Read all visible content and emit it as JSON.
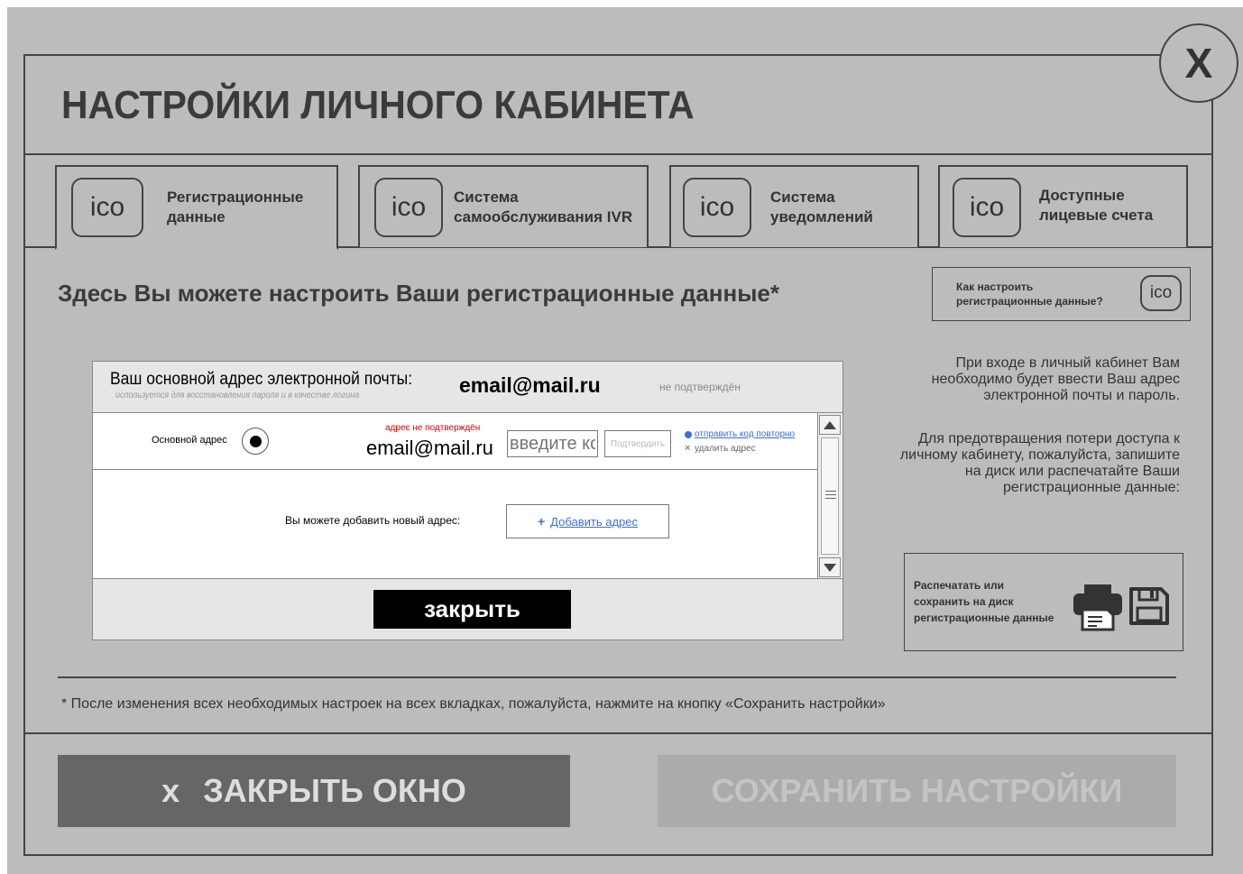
{
  "window": {
    "title": "НАСТРОЙКИ ЛИЧНОГО КАБИНЕТА",
    "close_glyph": "X"
  },
  "tabs": [
    {
      "icon": "ico",
      "label_line1": "Регистрационные",
      "label_line2": "данные",
      "active": true
    },
    {
      "icon": "ico",
      "label_line1": "Система",
      "label_line2": "самообслуживания IVR",
      "active": false
    },
    {
      "icon": "ico",
      "label_line1": "Система",
      "label_line2": "уведомлений",
      "active": false
    },
    {
      "icon": "ico",
      "label_line1": "Доступные",
      "label_line2": "лицевые счета",
      "active": false
    }
  ],
  "section": {
    "title": "Здесь Вы можете настроить Ваши регистрационные данные*"
  },
  "help": {
    "line1": "Как настроить",
    "line2": "регистрационные данные?",
    "icon": "ico"
  },
  "dialog": {
    "header_label": "Ваш основной адрес электронной почты:",
    "header_sublabel": "используется для восстановления пароля и в качестве логина",
    "header_email": "email@mail.ru",
    "header_status": "не подтверждён",
    "row": {
      "label": "Основной адрес",
      "warning": "адрес не подтверждён",
      "email": "email@mail.ru",
      "code_placeholder": "введите код",
      "confirm_label": "Подтвердить",
      "resend_label": "отправить код повторно",
      "delete_label": "удалить адрес"
    },
    "add_label": "Вы можете добавить новый адрес:",
    "add_button_icon": "+",
    "add_button_label": "Добавить адрес",
    "close_label": "закрыть"
  },
  "side": {
    "paragraph1": [
      "При входе в личный кабинет Вам",
      "необходимо будет ввести Ваш адрес",
      "электронной почты и пароль."
    ],
    "paragraph2": [
      "Для предотвращения потери доступа к",
      "личному кабинету, пожалуйста, запишите",
      "на диск или распечатайте Ваши",
      "регистрационные данные:"
    ],
    "print_text": [
      "Распечатать или",
      "сохранить на диск",
      "регистрационные данные"
    ]
  },
  "footnote": "* После изменения всех необходимых настроек на всех вкладках, пожалуйста, нажмите на кнопку «Сохранить настройки»",
  "buttons": {
    "close_prefix": "x",
    "close_label": "ЗАКРЫТЬ ОКНО",
    "save_label": "СОХРАНИТЬ НАСТРОЙКИ"
  },
  "colors": {
    "background": "#bcbcbc",
    "border": "#444444",
    "link": "#3a6fd8",
    "warning": "#e00000",
    "dialog_close_bg": "#000000",
    "close_button_bg": "#666666",
    "save_button_bg": "#ababab"
  }
}
